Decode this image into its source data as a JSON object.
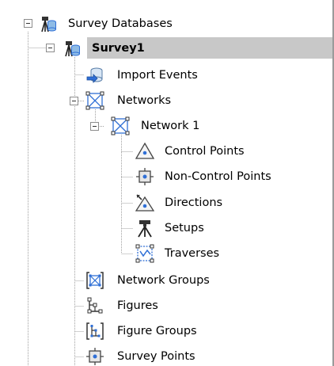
{
  "tree": {
    "root": {
      "label": "Survey Databases",
      "icon": "survey-databases-icon"
    },
    "survey": {
      "label": "Survey1",
      "icon": "survey-icon",
      "selected": true
    },
    "import_events": {
      "label": "Import Events",
      "icon": "import-events-icon"
    },
    "networks": {
      "label": "Networks",
      "icon": "networks-icon"
    },
    "network1": {
      "label": "Network 1",
      "icon": "network-icon"
    },
    "control_points": {
      "label": "Control Points",
      "icon": "control-points-icon"
    },
    "non_control_points": {
      "label": "Non-Control Points",
      "icon": "non-control-points-icon"
    },
    "directions": {
      "label": "Directions",
      "icon": "directions-icon"
    },
    "setups": {
      "label": "Setups",
      "icon": "setups-icon"
    },
    "traverses": {
      "label": "Traverses",
      "icon": "traverses-icon"
    },
    "network_groups": {
      "label": "Network Groups",
      "icon": "network-groups-icon"
    },
    "figures": {
      "label": "Figures",
      "icon": "figures-icon"
    },
    "figure_groups": {
      "label": "Figure Groups",
      "icon": "figure-groups-icon"
    },
    "survey_points": {
      "label": "Survey Points",
      "icon": "survey-points-icon"
    }
  },
  "colors": {
    "selection": "#c8c8c8",
    "tree_line": "#a0a0a0",
    "accent_blue": "#2f6fd6"
  }
}
